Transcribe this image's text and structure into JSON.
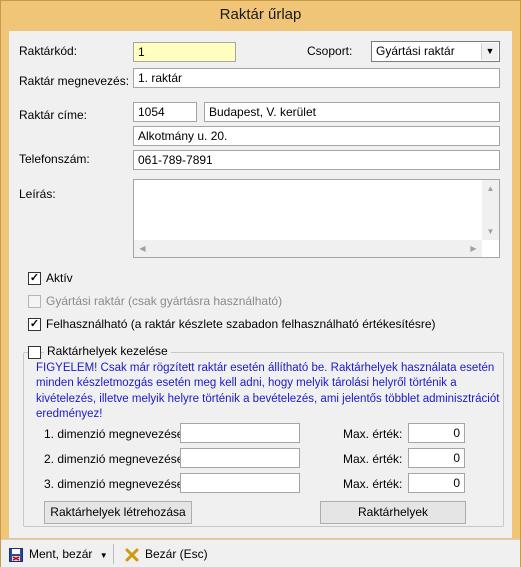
{
  "window": {
    "title": "Raktár űrlap"
  },
  "form": {
    "code_label": "Raktárkód:",
    "code_value": "1",
    "group_label": "Csoport:",
    "group_value": "Gyártási raktár",
    "name_label": "Raktár megnevezés:",
    "name_value": "1. raktár",
    "address_label": "Raktár címe:",
    "zip_value": "1054",
    "city_value": "Budapest, V. kerület",
    "street_value": "Alkotmány u. 20.",
    "phone_label": "Telefonszám:",
    "phone_value": "061-789-7891",
    "desc_label": "Leírás:",
    "desc_value": ""
  },
  "checks": {
    "active_label": "Aktív",
    "active_checked": true,
    "production_label": "Gyártási raktár (csak gyártásra használható)",
    "production_checked": false,
    "usable_label": "Felhasználható (a raktár készlete szabadon felhasználható értékesítésre)",
    "usable_checked": true
  },
  "locations": {
    "manage_label": "Raktárhelyek kezelése",
    "manage_checked": false,
    "warning_lines": [
      "FIGYELEM! Csak már rögzített raktár esetén állítható be. Raktárhelyek használata esetén",
      "minden készletmozgás esetén meg kell adni, hogy melyik tárolási helyről történik a",
      "kivételezés, illetve melyik helyre történik a bevételezés, ami jelentős többlet adminisztrációt",
      "eredményez!"
    ],
    "dims": [
      {
        "label": "1. dimenzió megnevezése:",
        "value": "",
        "max_label": "Max. érték:",
        "max_value": "0"
      },
      {
        "label": "2. dimenzió megnevezése:",
        "value": "",
        "max_label": "Max. érték:",
        "max_value": "0"
      },
      {
        "label": "3. dimenzió megnevezése:",
        "value": "",
        "max_label": "Max. érték:",
        "max_value": "0"
      }
    ],
    "create_button": "Raktárhelyek létrehozása",
    "list_button": "Raktárhelyek"
  },
  "toolbar": {
    "save_label": "Ment, bezár",
    "save_icon": "save-close-icon",
    "close_label": "Bezár (Esc)",
    "close_icon": "close-x-icon",
    "check_mark": "✓",
    "arrow_down": "▼",
    "arrow_up": "▲",
    "arrow_left": "◀",
    "arrow_right": "▶"
  }
}
